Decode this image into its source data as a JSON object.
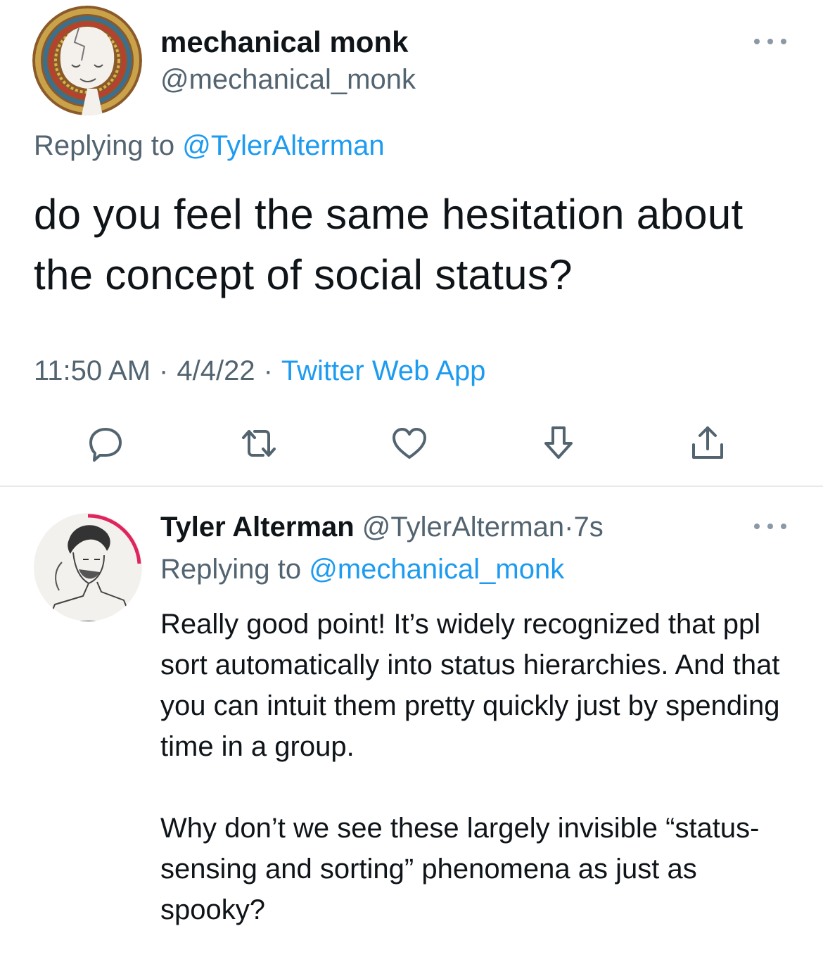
{
  "main_tweet": {
    "author_name": "mechanical monk",
    "author_handle": "@mechanical_monk",
    "replying_prefix": "Replying to",
    "replying_to": "@TylerAlterman",
    "text": "do you feel the same hesitation about the concept of social status?",
    "time": "11:50 AM",
    "separator": "·",
    "date": "4/4/22",
    "source": "Twitter Web App",
    "more_icon": "more-horizontal-icon"
  },
  "actions": [
    {
      "name": "reply",
      "icon": "reply-bubble-icon"
    },
    {
      "name": "retweet",
      "icon": "retweet-arrows-icon"
    },
    {
      "name": "like",
      "icon": "heart-icon"
    },
    {
      "name": "downvote",
      "icon": "down-arrow-icon"
    },
    {
      "name": "share",
      "icon": "share-upload-icon"
    }
  ],
  "reply_tweet": {
    "author_name": "Tyler Alterman",
    "author_handle": "@TylerAlterman",
    "separator": "·",
    "time_ago": "7s",
    "replying_prefix": "Replying to",
    "replying_to": "@mechanical_monk",
    "paragraphs": [
      "Really good point! It’s widely recognized that ppl sort automatically into status hierarchies. And that you can intuit them pretty quickly just by spending time in a group.",
      "Why don’t we see these largely invisible “status-sensing and sorting” phenomena as just as spooky?"
    ],
    "more_icon": "more-horizontal-icon"
  },
  "colors": {
    "text_primary": "#0f1419",
    "text_secondary": "#536471",
    "link": "#1d9bf0",
    "icon": "#536471",
    "divider": "#e7e9ea",
    "avatar_ring": "#e0245e"
  }
}
